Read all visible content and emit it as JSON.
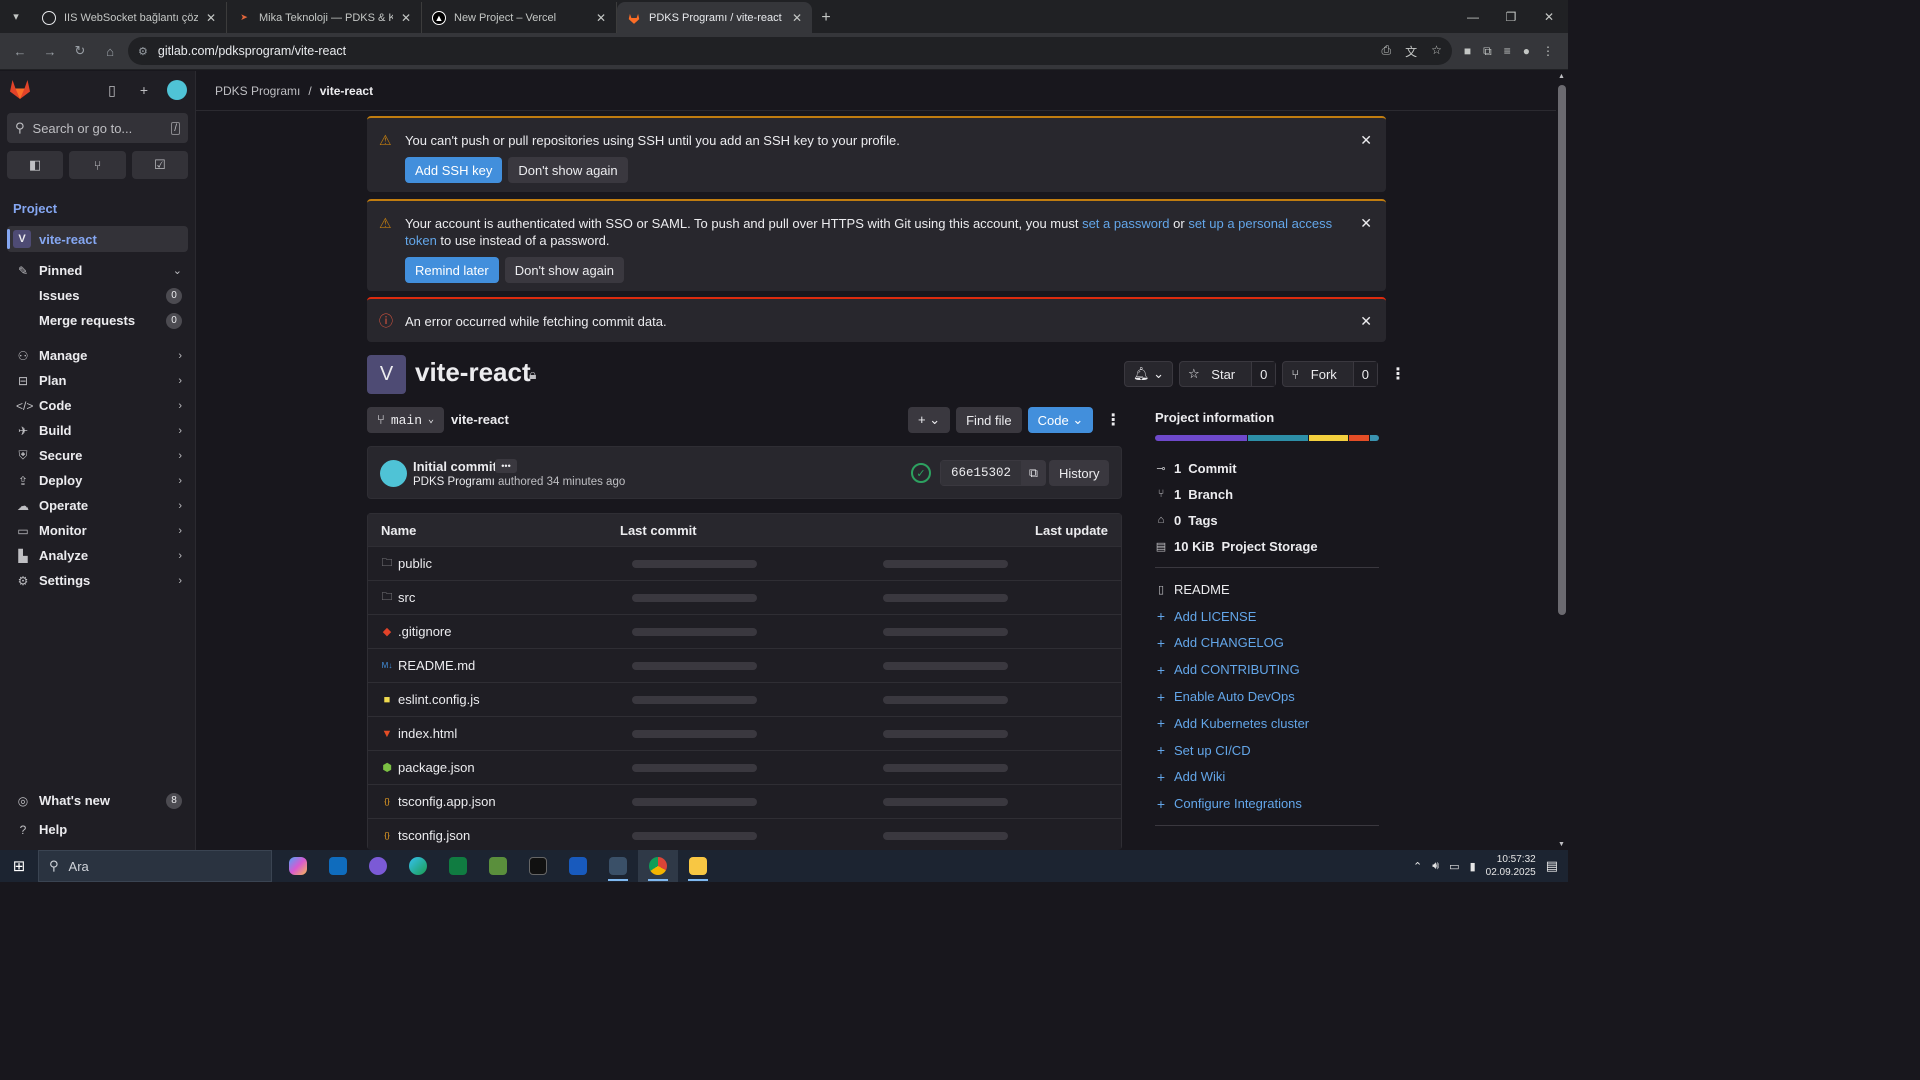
{
  "browser": {
    "tabs": [
      {
        "title": "IIS WebSocket bağlantı çözümü",
        "favicon_color": "#e8eaed",
        "active": false
      },
      {
        "title": "Mika Teknoloji — PDKS & Kartlı",
        "favicon_color": "#e2663b",
        "active": false
      },
      {
        "title": "New Project – Vercel",
        "favicon_color": "#ffffff",
        "active": false
      },
      {
        "title": "PDKS Programı / vite-react · GitLab",
        "favicon_color": "#fc6d26",
        "active": true
      }
    ],
    "url": "gitlab.com/pdksprogram/vite-react"
  },
  "sidebar": {
    "search_placeholder": "Search or go to...",
    "search_kbd": "/",
    "section_label": "Project",
    "project": {
      "initial": "V",
      "name": "vite-react"
    },
    "pinned": {
      "label": "Pinned",
      "items": [
        {
          "label": "Issues",
          "count": "0"
        },
        {
          "label": "Merge requests",
          "count": "0"
        }
      ]
    },
    "nav": [
      {
        "label": "Manage",
        "icon": "users-icon"
      },
      {
        "label": "Plan",
        "icon": "planning-icon"
      },
      {
        "label": "Code",
        "icon": "code-icon"
      },
      {
        "label": "Build",
        "icon": "rocket-icon"
      },
      {
        "label": "Secure",
        "icon": "shield-icon"
      },
      {
        "label": "Deploy",
        "icon": "deployments-icon"
      },
      {
        "label": "Operate",
        "icon": "cloud-icon"
      },
      {
        "label": "Monitor",
        "icon": "monitor-icon"
      },
      {
        "label": "Analyze",
        "icon": "chart-icon"
      },
      {
        "label": "Settings",
        "icon": "gear-icon"
      }
    ],
    "whats_new": {
      "label": "What's new",
      "count": "8"
    },
    "help": "Help"
  },
  "breadcrumb": {
    "group": "PDKS Programı",
    "separator": "/",
    "project": "vite-react"
  },
  "alerts": {
    "ssh": {
      "text": "You can't push or pull repositories using SSH until you add an SSH key to your profile.",
      "primary": "Add SSH key",
      "secondary": "Don't show again"
    },
    "sso": {
      "text_before": "Your account is authenticated with SSO or SAML. To push and pull over HTTPS with Git using this account, you must ",
      "link1": "set a password",
      "text_mid": " or ",
      "link2": "set up a personal access token",
      "text_after": " to use instead of a password.",
      "primary": "Remind later",
      "secondary": "Don't show again"
    },
    "error": {
      "text": "An error occurred while fetching commit data."
    }
  },
  "project": {
    "initial": "V",
    "name": "vite-react",
    "star_label": "Star",
    "star_count": "0",
    "fork_label": "Fork",
    "fork_count": "0"
  },
  "repo": {
    "branch": "main",
    "path": "vite-react",
    "find_file": "Find file",
    "code_label": "Code"
  },
  "commit": {
    "title": "Initial commit",
    "author": "PDKS Programı",
    "authored_text": "authored 34 minutes ago",
    "sha": "66e15302",
    "history": "History"
  },
  "files": {
    "headers": {
      "name": "Name",
      "last_commit": "Last commit",
      "last_update": "Last update"
    },
    "rows": [
      {
        "name": "public",
        "icon": "folder-icon",
        "color": "#bfbfc3"
      },
      {
        "name": "src",
        "icon": "folder-icon",
        "color": "#bfbfc3"
      },
      {
        "name": ".gitignore",
        "icon": "git-icon",
        "color": "#e24329"
      },
      {
        "name": "README.md",
        "icon": "markdown-icon",
        "color": "#428fdc"
      },
      {
        "name": "eslint.config.js",
        "icon": "js-icon",
        "color": "#f0db4f"
      },
      {
        "name": "index.html",
        "icon": "html-icon",
        "color": "#e44d26"
      },
      {
        "name": "package.json",
        "icon": "nodejs-icon",
        "color": "#7bc043"
      },
      {
        "name": "tsconfig.app.json",
        "icon": "json-icon",
        "color": "#f5a623"
      },
      {
        "name": "tsconfig.json",
        "icon": "json-icon",
        "color": "#f5a623"
      }
    ]
  },
  "project_info": {
    "title": "Project information",
    "languages": [
      {
        "color": "#6e49cb",
        "share": 0.42
      },
      {
        "color": "#2d8fa8",
        "share": 0.27
      },
      {
        "color": "#f3d03e",
        "share": 0.18
      },
      {
        "color": "#e44d26",
        "share": 0.09
      },
      {
        "color": "#3a93b0",
        "share": 0.04
      }
    ],
    "stats": [
      {
        "icon": "commit-icon",
        "count": "1",
        "label": "Commit"
      },
      {
        "icon": "branch-icon",
        "count": "1",
        "label": "Branch"
      },
      {
        "icon": "tag-icon",
        "count": "0",
        "label": "Tags"
      },
      {
        "icon": "disk-icon",
        "count": "10 KiB",
        "label": "Project Storage"
      }
    ],
    "readme": "README",
    "links": [
      "Add LICENSE",
      "Add CHANGELOG",
      "Add CONTRIBUTING",
      "Enable Auto DevOps",
      "Add Kubernetes cluster",
      "Set up CI/CD",
      "Add Wiki",
      "Configure Integrations"
    ]
  },
  "taskbar": {
    "search_placeholder": "Ara",
    "time": "10:57:32",
    "date": "02.09.2025"
  }
}
